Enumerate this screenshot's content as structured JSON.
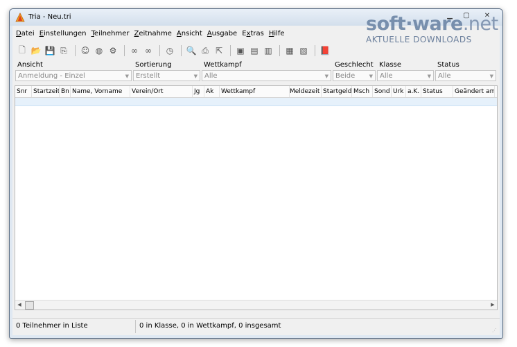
{
  "window": {
    "title": "Tria  -  Neu.tri"
  },
  "menu": [
    {
      "underline": "D",
      "rest": "atei"
    },
    {
      "underline": "E",
      "rest": "instellungen"
    },
    {
      "underline": "T",
      "rest": "eilnehmer"
    },
    {
      "underline": "Z",
      "rest": "eitnahme"
    },
    {
      "underline": "A",
      "rest": "nsicht"
    },
    {
      "underline": "A",
      "rest": "usgabe"
    },
    {
      "pre": "E",
      "underline": "x",
      "rest": "tras"
    },
    {
      "underline": "H",
      "rest": "ilfe"
    }
  ],
  "toolbar_icons": [
    "new-file-icon",
    "open-folder-icon",
    "save-icon",
    "import-icon",
    "smiley-icon",
    "globe-icon",
    "settings-icon",
    "binoculars-icon",
    "binoculars-next-icon",
    "clock-icon",
    "print-preview-icon",
    "print-icon",
    "export-icon",
    "document-a-icon",
    "document-b-icon",
    "document-c-icon",
    "list-a-icon",
    "list-b-icon",
    "book-icon"
  ],
  "filters": {
    "ansicht": {
      "label": "Ansicht",
      "value": "Anmeldung - Einzel"
    },
    "sortierung": {
      "label": "Sortierung",
      "value": "Erstellt"
    },
    "wettkampf": {
      "label": "Wettkampf",
      "value": "Alle"
    },
    "geschlecht": {
      "label": "Geschlecht",
      "value": "Beide"
    },
    "klasse": {
      "label": "Klasse",
      "value": "Alle"
    },
    "status": {
      "label": "Status",
      "value": "Alle"
    }
  },
  "grid": {
    "columns": [
      "Snr",
      "Startzeit",
      "Bn",
      "Name, Vorname",
      "Verein/Ort",
      "Jg",
      "Ak",
      "Wettkampf",
      "Meldezeit",
      "Startgeld",
      "Msch",
      "Sond",
      "Urk",
      "a.K.",
      "Status",
      "Geändert am"
    ]
  },
  "statusbar": {
    "left": "0  Teilnehmer in Liste",
    "right": "0  in Klasse,  0  in Wettkampf,  0  insgesamt"
  },
  "watermark": {
    "logo_a": "soft",
    "logo_b": "ware",
    "logo_c": ".net",
    "sub": "AKTUELLE DOWNLOADS"
  },
  "colors": {
    "accent": "#6d86a6",
    "row_highlight": "#e6f1fb"
  }
}
